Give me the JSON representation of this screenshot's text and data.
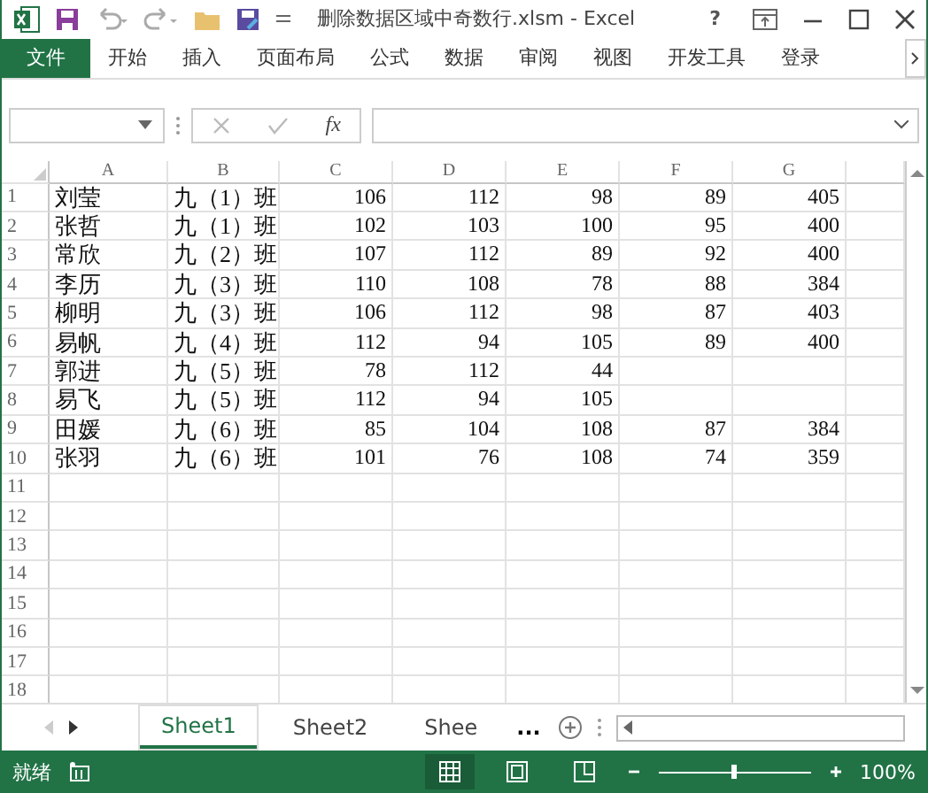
{
  "window": {
    "title": "删除数据区域中奇数行.xlsm - Excel",
    "help": "?"
  },
  "ribbon_tabs": [
    {
      "label": "文件",
      "selected": true
    },
    {
      "label": "开始",
      "selected": false
    },
    {
      "label": "插入",
      "selected": false
    },
    {
      "label": "页面布局",
      "selected": false
    },
    {
      "label": "公式",
      "selected": false
    },
    {
      "label": "数据",
      "selected": false
    },
    {
      "label": "审阅",
      "selected": false
    },
    {
      "label": "视图",
      "selected": false
    },
    {
      "label": "开发工具",
      "selected": false
    },
    {
      "label": "登录",
      "selected": false
    }
  ],
  "formula_bar": {
    "fx": "fx"
  },
  "sheet": {
    "columns": [
      "A",
      "B",
      "C",
      "D",
      "E",
      "F",
      "G"
    ],
    "rows": [
      {
        "number": "1",
        "cells": [
          "刘莹",
          "九（1）班",
          "106",
          "112",
          "98",
          "89",
          "405"
        ]
      },
      {
        "number": "2",
        "cells": [
          "张哲",
          "九（1）班",
          "102",
          "103",
          "100",
          "95",
          "400"
        ]
      },
      {
        "number": "3",
        "cells": [
          "常欣",
          "九（2）班",
          "107",
          "112",
          "89",
          "92",
          "400"
        ]
      },
      {
        "number": "4",
        "cells": [
          "李历",
          "九（3）班",
          "110",
          "108",
          "78",
          "88",
          "384"
        ]
      },
      {
        "number": "5",
        "cells": [
          "柳明",
          "九（3）班",
          "106",
          "112",
          "98",
          "87",
          "403"
        ]
      },
      {
        "number": "6",
        "cells": [
          "易帆",
          "九（4）班",
          "112",
          "94",
          "105",
          "89",
          "400"
        ]
      },
      {
        "number": "7",
        "cells": [
          "郭进",
          "九（5）班",
          "78",
          "112",
          "44"
        ]
      },
      {
        "number": "8",
        "cells": [
          "易飞",
          "九（5）班",
          "112",
          "94",
          "105"
        ]
      },
      {
        "number": "9",
        "cells": [
          "田媛",
          "九（6）班",
          "85",
          "104",
          "108",
          "87",
          "384"
        ]
      },
      {
        "number": "10",
        "cells": [
          "张羽",
          "九（6）班",
          "101",
          "76",
          "108",
          "74",
          "359"
        ]
      },
      {
        "number": "11"
      },
      {
        "number": "12"
      },
      {
        "number": "13"
      },
      {
        "number": "14"
      },
      {
        "number": "15"
      },
      {
        "number": "16"
      },
      {
        "number": "17"
      },
      {
        "number": "18"
      }
    ]
  },
  "sheet_tabs": [
    {
      "label": "Sheet1",
      "selected": true
    },
    {
      "label": "Sheet2",
      "selected": false
    },
    {
      "label": "Shee",
      "selected": false
    }
  ],
  "more_sheets": "...",
  "status_bar": {
    "status": "就绪",
    "zoom": "100%",
    "zoom_slider": {
      "level": 0.5
    }
  }
}
